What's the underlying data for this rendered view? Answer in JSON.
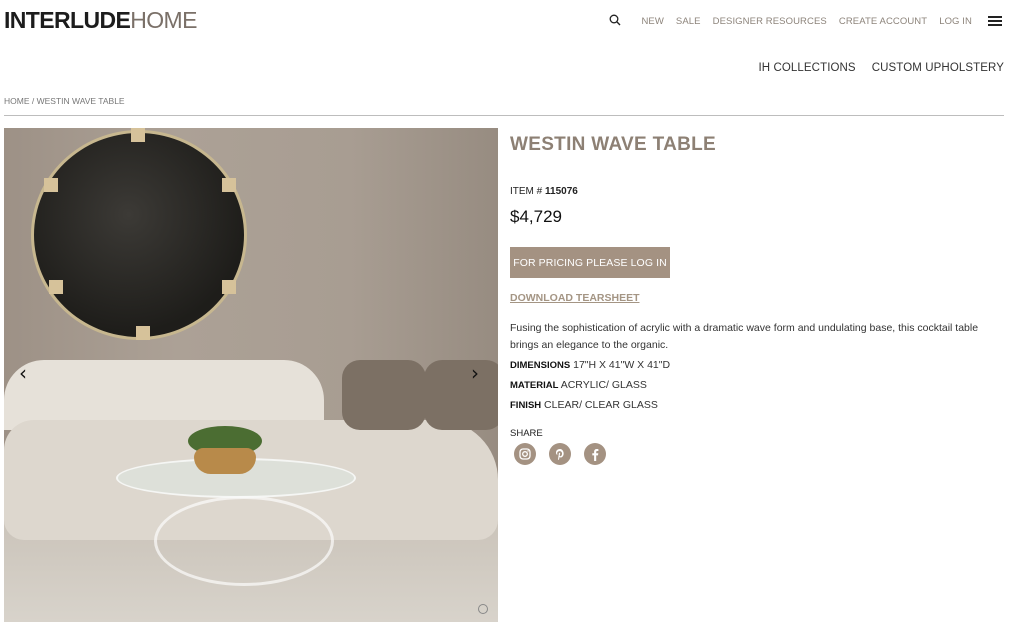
{
  "header": {
    "logo_part1": "INTERLUDE",
    "logo_part2": "HOME",
    "nav": {
      "new": "NEW",
      "sale": "SALE",
      "designer_resources": "DESIGNER RESOURCES",
      "create_account": "CREATE ACCOUNT",
      "log_in": "LOG IN"
    }
  },
  "subnav": {
    "collections": "IH COLLECTIONS",
    "upholstery": "CUSTOM UPHOLSTERY"
  },
  "breadcrumb": {
    "home": "HOME",
    "separator": " / ",
    "current": "WESTIN WAVE TABLE"
  },
  "product": {
    "title": "WESTIN WAVE TABLE",
    "item_label": "ITEM # ",
    "item_number": "115076",
    "price": "$4,729",
    "login_button": "FOR PRICING PLEASE LOG IN",
    "tearsheet_link": "DOWNLOAD TEARSHEET",
    "description": "Fusing the sophistication of acrylic with a dramatic wave form and undulating base, this cocktail table brings an elegance to the organic.",
    "specs": {
      "dimensions_label": "DIMENSIONS",
      "dimensions_value": " 17\"H X 41\"W X 41\"D",
      "material_label": "MATERIAL",
      "material_value": " ACRYLIC/ GLASS",
      "finish_label": "FINISH",
      "finish_value": " CLEAR/ CLEAR GLASS"
    },
    "share_label": "SHARE"
  },
  "gallery": {
    "prev": "‹",
    "next": "›"
  },
  "colors": {
    "accent": "#a49282",
    "title": "#8d8074",
    "nav_text": "#8d847b"
  },
  "icons": [
    "search-icon",
    "hamburger-menu-icon",
    "instagram-icon",
    "pinterest-icon",
    "facebook-icon",
    "chevron-left-icon",
    "chevron-right-icon",
    "zoom-icon"
  ]
}
